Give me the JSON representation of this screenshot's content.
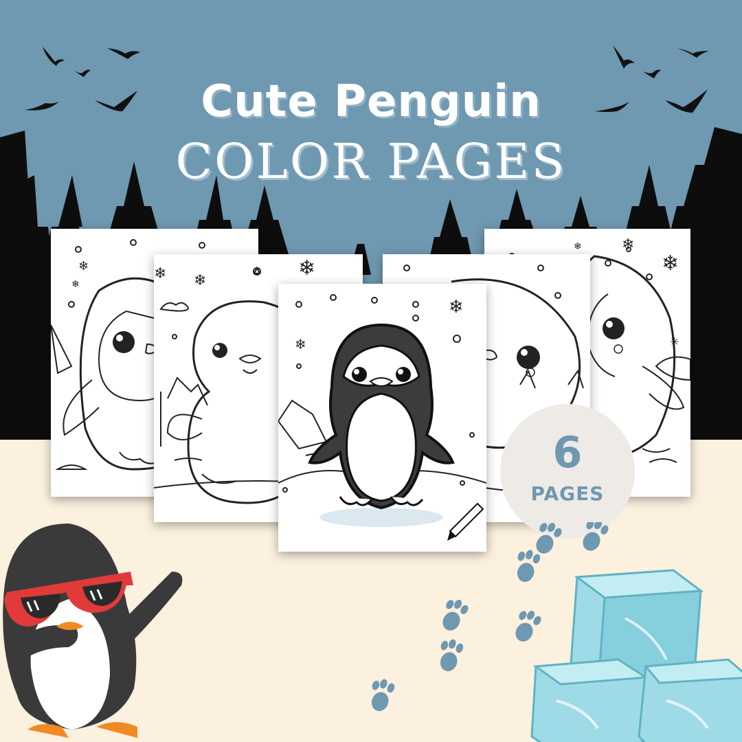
{
  "title": {
    "line1": "Cute Penguin",
    "line2": "COLOR PAGES"
  },
  "badge": {
    "count": "6",
    "label": "PAGES"
  },
  "colors": {
    "sky": "#6f98b1",
    "ground": "#fcf0df",
    "trees": "#0d0d0d",
    "badge_bg": "#eeeae6",
    "badge_text": "#6f98b1",
    "ice": "#8fd3df",
    "paw_prints": "#6f98b1",
    "sunglasses": "#e03a3a"
  },
  "preview_pages": [
    {
      "name": "page-penguin-side",
      "style": "outline"
    },
    {
      "name": "page-penguin-waving",
      "style": "outline"
    },
    {
      "name": "page-penguin-peek",
      "style": "outline"
    },
    {
      "name": "page-penguin-cat-ears",
      "style": "outline"
    },
    {
      "name": "page-penguin-front",
      "style": "filled"
    }
  ],
  "decorations": [
    "bird-silhouette",
    "pine-tree",
    "snowflake",
    "paw-print",
    "ice-cube",
    "dabbing-penguin",
    "pencil"
  ]
}
